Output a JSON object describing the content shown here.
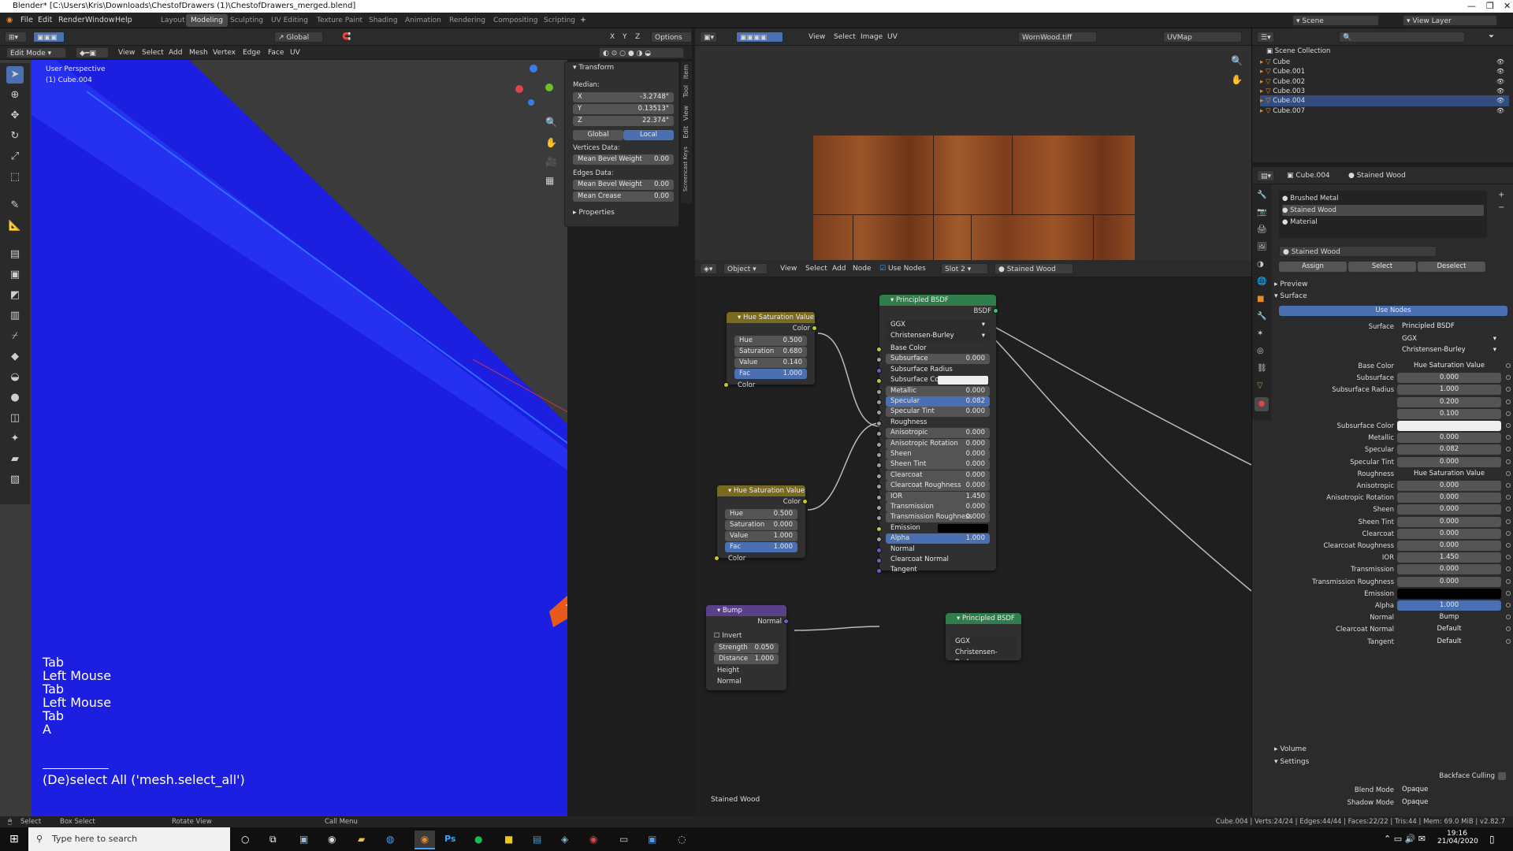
{
  "window": {
    "title": "Blender* [C:\\Users\\Kris\\Downloads\\ChestofDrawers (1)\\ChestofDrawers_merged.blend]"
  },
  "menu": [
    "File",
    "Edit",
    "Render",
    "Window",
    "Help"
  ],
  "workspaces": [
    "Layout",
    "Modeling",
    "Sculpting",
    "UV Editing",
    "Texture Paint",
    "Shading",
    "Animation",
    "Rendering",
    "Compositing",
    "Scripting"
  ],
  "active_workspace": "Modeling",
  "topright": {
    "scene": "Scene",
    "view_layer": "View Layer"
  },
  "viewport": {
    "mode": "Edit Mode",
    "menus": [
      "View",
      "Select",
      "Add",
      "Mesh",
      "Vertex",
      "Edge",
      "Face",
      "UV"
    ],
    "orientation": "Global",
    "options": "Options",
    "perspective": "User Perspective",
    "object": "(1) Cube.004",
    "keys": [
      "Tab",
      "Left Mouse",
      "Tab",
      "Left Mouse",
      "Tab",
      "A"
    ],
    "op_label": "(De)select All ('mesh.select_all')",
    "xyz": [
      "X",
      "Y",
      "Z"
    ]
  },
  "npanel": {
    "transform": "Transform",
    "median": "Median:",
    "x": {
      "label": "X",
      "value": "-3.2748°"
    },
    "y": {
      "label": "Y",
      "value": "0.13513°"
    },
    "z": {
      "label": "Z",
      "value": "22.374°"
    },
    "global": "Global",
    "local": "Local",
    "vertices_data": "Vertices Data:",
    "mean_bevel_weight": "Mean Bevel Weight",
    "mbw_v": "0.00",
    "edges_data": "Edges Data:",
    "mbw_e": "0.00",
    "mean_crease": "Mean Crease",
    "mc_v": "0.00",
    "properties": "Properties",
    "tabs": [
      "Item",
      "Tool",
      "View",
      "Edit",
      "Screencast Keys"
    ]
  },
  "image_editor": {
    "menus": [
      "View",
      "Select",
      "Image",
      "UV"
    ],
    "image": "WornWood.tiff",
    "uvmap": "UVMap"
  },
  "node_editor": {
    "object": "Object",
    "menus": [
      "View",
      "Select",
      "Add",
      "Node"
    ],
    "use_nodes": "Use Nodes",
    "slot": "Slot 2",
    "material": "Stained Wood",
    "bottom_label": "Stained Wood",
    "hsv1": {
      "title": "Hue Saturation Value",
      "out": "Color",
      "hue": "0.500",
      "sat": "0.680",
      "val": "0.140",
      "fac": "1.000",
      "in": "Color"
    },
    "hsv2": {
      "title": "Hue Saturation Value",
      "out": "Color",
      "hue": "0.500",
      "sat": "0.000",
      "val": "1.000",
      "fac": "1.000",
      "in": "Color"
    },
    "labels": {
      "hue": "Hue",
      "sat": "Saturation",
      "val": "Value",
      "fac": "Fac"
    },
    "bump": {
      "title": "Bump",
      "out": "Normal",
      "invert": "Invert",
      "strength_l": "Strength",
      "strength": "0.050",
      "distance_l": "Distance",
      "distance": "1.000",
      "height": "Height",
      "normal": "Normal"
    },
    "bsdf": {
      "title": "Principled BSDF",
      "out": "BSDF",
      "dist": "GGX",
      "sss": "Christensen-Burley",
      "rows": [
        {
          "k": "Base Color",
          "v": ""
        },
        {
          "k": "Subsurface",
          "v": "0.000"
        },
        {
          "k": "Subsurface Radius",
          "v": ""
        },
        {
          "k": "Subsurface Color",
          "v": ""
        },
        {
          "k": "Metallic",
          "v": "0.000"
        },
        {
          "k": "Specular",
          "v": "0.082"
        },
        {
          "k": "Specular Tint",
          "v": "0.000"
        },
        {
          "k": "Roughness",
          "v": ""
        },
        {
          "k": "Anisotropic",
          "v": "0.000"
        },
        {
          "k": "Anisotropic Rotation",
          "v": "0.000"
        },
        {
          "k": "Sheen",
          "v": "0.000"
        },
        {
          "k": "Sheen Tint",
          "v": "0.000"
        },
        {
          "k": "Clearcoat",
          "v": "0.000"
        },
        {
          "k": "Clearcoat Roughness",
          "v": "0.000"
        },
        {
          "k": "IOR",
          "v": "1.450"
        },
        {
          "k": "Transmission",
          "v": "0.000"
        },
        {
          "k": "Transmission Roughness",
          "v": "0.000"
        },
        {
          "k": "Emission",
          "v": ""
        },
        {
          "k": "Alpha",
          "v": "1.000"
        },
        {
          "k": "Normal",
          "v": ""
        },
        {
          "k": "Clearcoat Normal",
          "v": ""
        },
        {
          "k": "Tangent",
          "v": ""
        }
      ]
    },
    "bsdf2": {
      "title": "Principled BSDF",
      "dist": "GGX",
      "sss": "Christensen-Burley"
    }
  },
  "outliner": {
    "title": "Scene Collection",
    "items": [
      "Cube",
      "Cube.001",
      "Cube.002",
      "Cube.003",
      "Cube.004",
      "Cube.007"
    ],
    "selected": "Cube.004"
  },
  "properties": {
    "object": "Cube.004",
    "material": "Stained Wood",
    "slots": [
      "Brushed Metal",
      "Stained Wood",
      "Material"
    ],
    "mat_name": "Stained Wood",
    "assign": "Assign",
    "select": "Select",
    "deselect": "Deselect",
    "preview": "Preview",
    "surface": "Surface",
    "use_nodes": "Use Nodes",
    "surface_l": "Surface",
    "surface_v": "Principled BSDF",
    "dist": "GGX",
    "sss": "Christensen-Burley",
    "rows": [
      {
        "k": "Base Color",
        "v": "Hue Saturation Value"
      },
      {
        "k": "Subsurface",
        "v": "0.000"
      },
      {
        "k": "Subsurface Radius",
        "v": "1.000"
      },
      {
        "k": "",
        "v": "0.200"
      },
      {
        "k": "",
        "v": "0.100"
      },
      {
        "k": "Subsurface Color",
        "v": ""
      },
      {
        "k": "Metallic",
        "v": "0.000"
      },
      {
        "k": "Specular",
        "v": "0.082"
      },
      {
        "k": "Specular Tint",
        "v": "0.000"
      },
      {
        "k": "Roughness",
        "v": "Hue Saturation Value"
      },
      {
        "k": "Anisotropic",
        "v": "0.000"
      },
      {
        "k": "Anisotropic Rotation",
        "v": "0.000"
      },
      {
        "k": "Sheen",
        "v": "0.000"
      },
      {
        "k": "Sheen Tint",
        "v": "0.000"
      },
      {
        "k": "Clearcoat",
        "v": "0.000"
      },
      {
        "k": "Clearcoat Roughness",
        "v": "0.000"
      },
      {
        "k": "IOR",
        "v": "1.450"
      },
      {
        "k": "Transmission",
        "v": "0.000"
      },
      {
        "k": "Transmission Roughness",
        "v": "0.000"
      },
      {
        "k": "Emission",
        "v": ""
      },
      {
        "k": "Alpha",
        "v": "1.000"
      },
      {
        "k": "Normal",
        "v": "Bump"
      },
      {
        "k": "Clearcoat Normal",
        "v": "Default"
      },
      {
        "k": "Tangent",
        "v": "Default"
      }
    ],
    "volume": "Volume",
    "settings": "Settings",
    "backface": "Backface Culling",
    "blend_l": "Blend Mode",
    "blend_v": "Opaque",
    "shadow_l": "Shadow Mode",
    "shadow_v": "Opaque"
  },
  "statusbar": {
    "select": "Select",
    "box": "Box Select",
    "rotate": "Rotate View",
    "call": "Call Menu",
    "stats": "Cube.004 | Verts:24/24 | Edges:44/44 | Faces:22/22 | Tris:44 | Mem: 69.0 MiB | v2.82.7"
  },
  "taskbar": {
    "search": "Type here to search",
    "time": "19:16",
    "date": "21/04/2020"
  },
  "colors": {
    "accent": "#4a6fb3",
    "mesh": "#1c1ee0",
    "face": "#e85a1c",
    "hsv_header": "#7a6a1f",
    "bsdf_header": "#2e7d4a",
    "bump_header": "#5a3f8a"
  }
}
